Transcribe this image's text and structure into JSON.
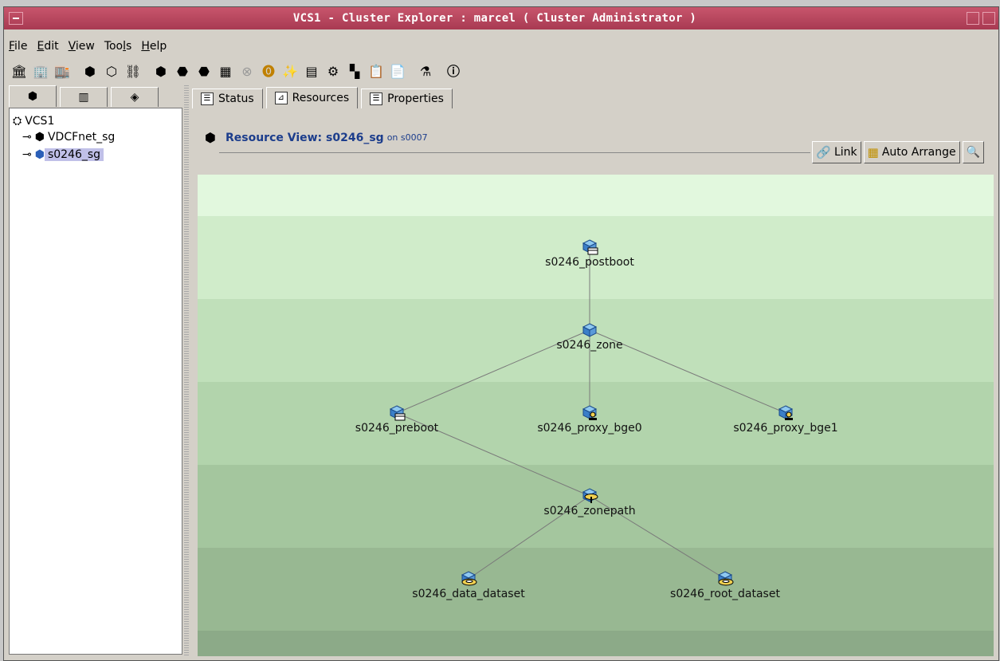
{
  "window": {
    "title": "VCS1 - Cluster Explorer : marcel ( Cluster Administrator )"
  },
  "menu": [
    {
      "pre": "",
      "key": "F",
      "post": "ile"
    },
    {
      "pre": "",
      "key": "E",
      "post": "dit"
    },
    {
      "pre": "",
      "key": "V",
      "post": "iew"
    },
    {
      "pre": "Too",
      "key": "l",
      "post": "s"
    },
    {
      "pre": "",
      "key": "H",
      "post": "elp"
    }
  ],
  "toolbar_icons": [
    "add-system-icon",
    "add-node-icon",
    "remove-node-icon",
    "add-group-icon",
    "add-resource-icon",
    "link-group-icon",
    "group-icon",
    "online-icon",
    "offline-icon",
    "switch-icon",
    "disabled-icon",
    "alert-icon",
    "wizard-icon",
    "query-icon",
    "command-icon",
    "template-icon",
    "log-icon",
    "report-icon",
    "manage-icon",
    "help-icon"
  ],
  "left_tabs": [
    "service-groups-tab",
    "systems-tab",
    "resource-types-tab"
  ],
  "tree": {
    "root": "VCS1",
    "groups": [
      {
        "label": "VDCFnet_sg",
        "selected": false
      },
      {
        "label": "s0246_sg",
        "selected": true
      }
    ]
  },
  "tabs": [
    {
      "label": "Status",
      "active": false
    },
    {
      "label": "Resources",
      "active": true
    },
    {
      "label": "Properties",
      "active": false
    }
  ],
  "resource_view": {
    "title": "Resource View: s0246_sg",
    "on_text": "on s0007",
    "link_label": "Link",
    "auto_arrange_label": "Auto Arrange"
  },
  "resources": {
    "postboot": "s0246_postboot",
    "zone": "s0246_zone",
    "preboot": "s0246_preboot",
    "proxy0": "s0246_proxy_bge0",
    "proxy1": "s0246_proxy_bge1",
    "zonepath": "s0246_zonepath",
    "data": "s0246_data_dataset",
    "root": "s0246_root_dataset"
  },
  "dependencies": [
    [
      "postboot",
      "zone"
    ],
    [
      "zone",
      "preboot"
    ],
    [
      "zone",
      "proxy0"
    ],
    [
      "zone",
      "proxy1"
    ],
    [
      "preboot",
      "zonepath"
    ],
    [
      "zonepath",
      "data"
    ],
    [
      "zonepath",
      "root"
    ]
  ],
  "colors": {
    "title_bar": "#b8465e",
    "heading": "#1c3d8c",
    "selection": "#c0c0e8",
    "band_light": "#e0f8dc",
    "band_dark": "#8aa88a"
  }
}
